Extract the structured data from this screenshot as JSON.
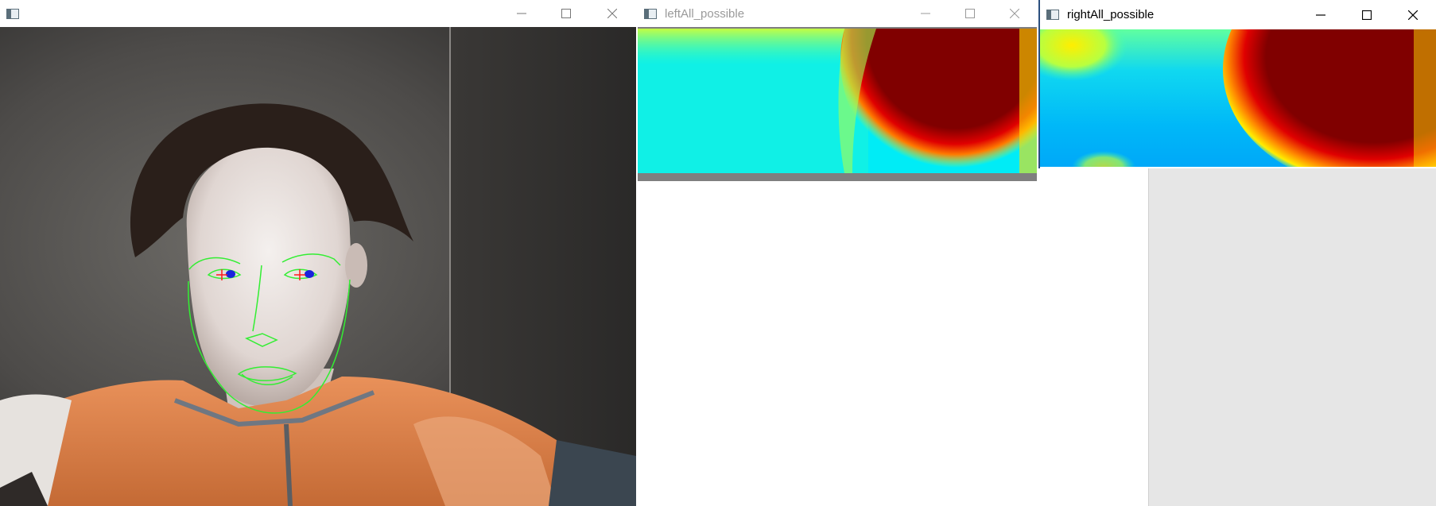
{
  "windows": {
    "camera": {
      "title": "",
      "active": false
    },
    "left": {
      "title": "leftAll_possible",
      "active": false
    },
    "right": {
      "title": "rightAll_possible",
      "active": true
    }
  },
  "controls": {
    "minimize_icon": "minimize-icon",
    "maximize_icon": "maximize-icon",
    "close_icon": "close-icon"
  },
  "colors": {
    "inactive_title": "#9a9a9a",
    "active_title": "#000000",
    "active_border": "#2b4f7e",
    "heatmap_low": "#00e5ff",
    "heatmap_mid": "#ffff00",
    "heatmap_high": "#7f0000",
    "face_landmarks": "#33ff33",
    "pupil": "#0000ff",
    "eye_center_marker": "#ff0000"
  }
}
